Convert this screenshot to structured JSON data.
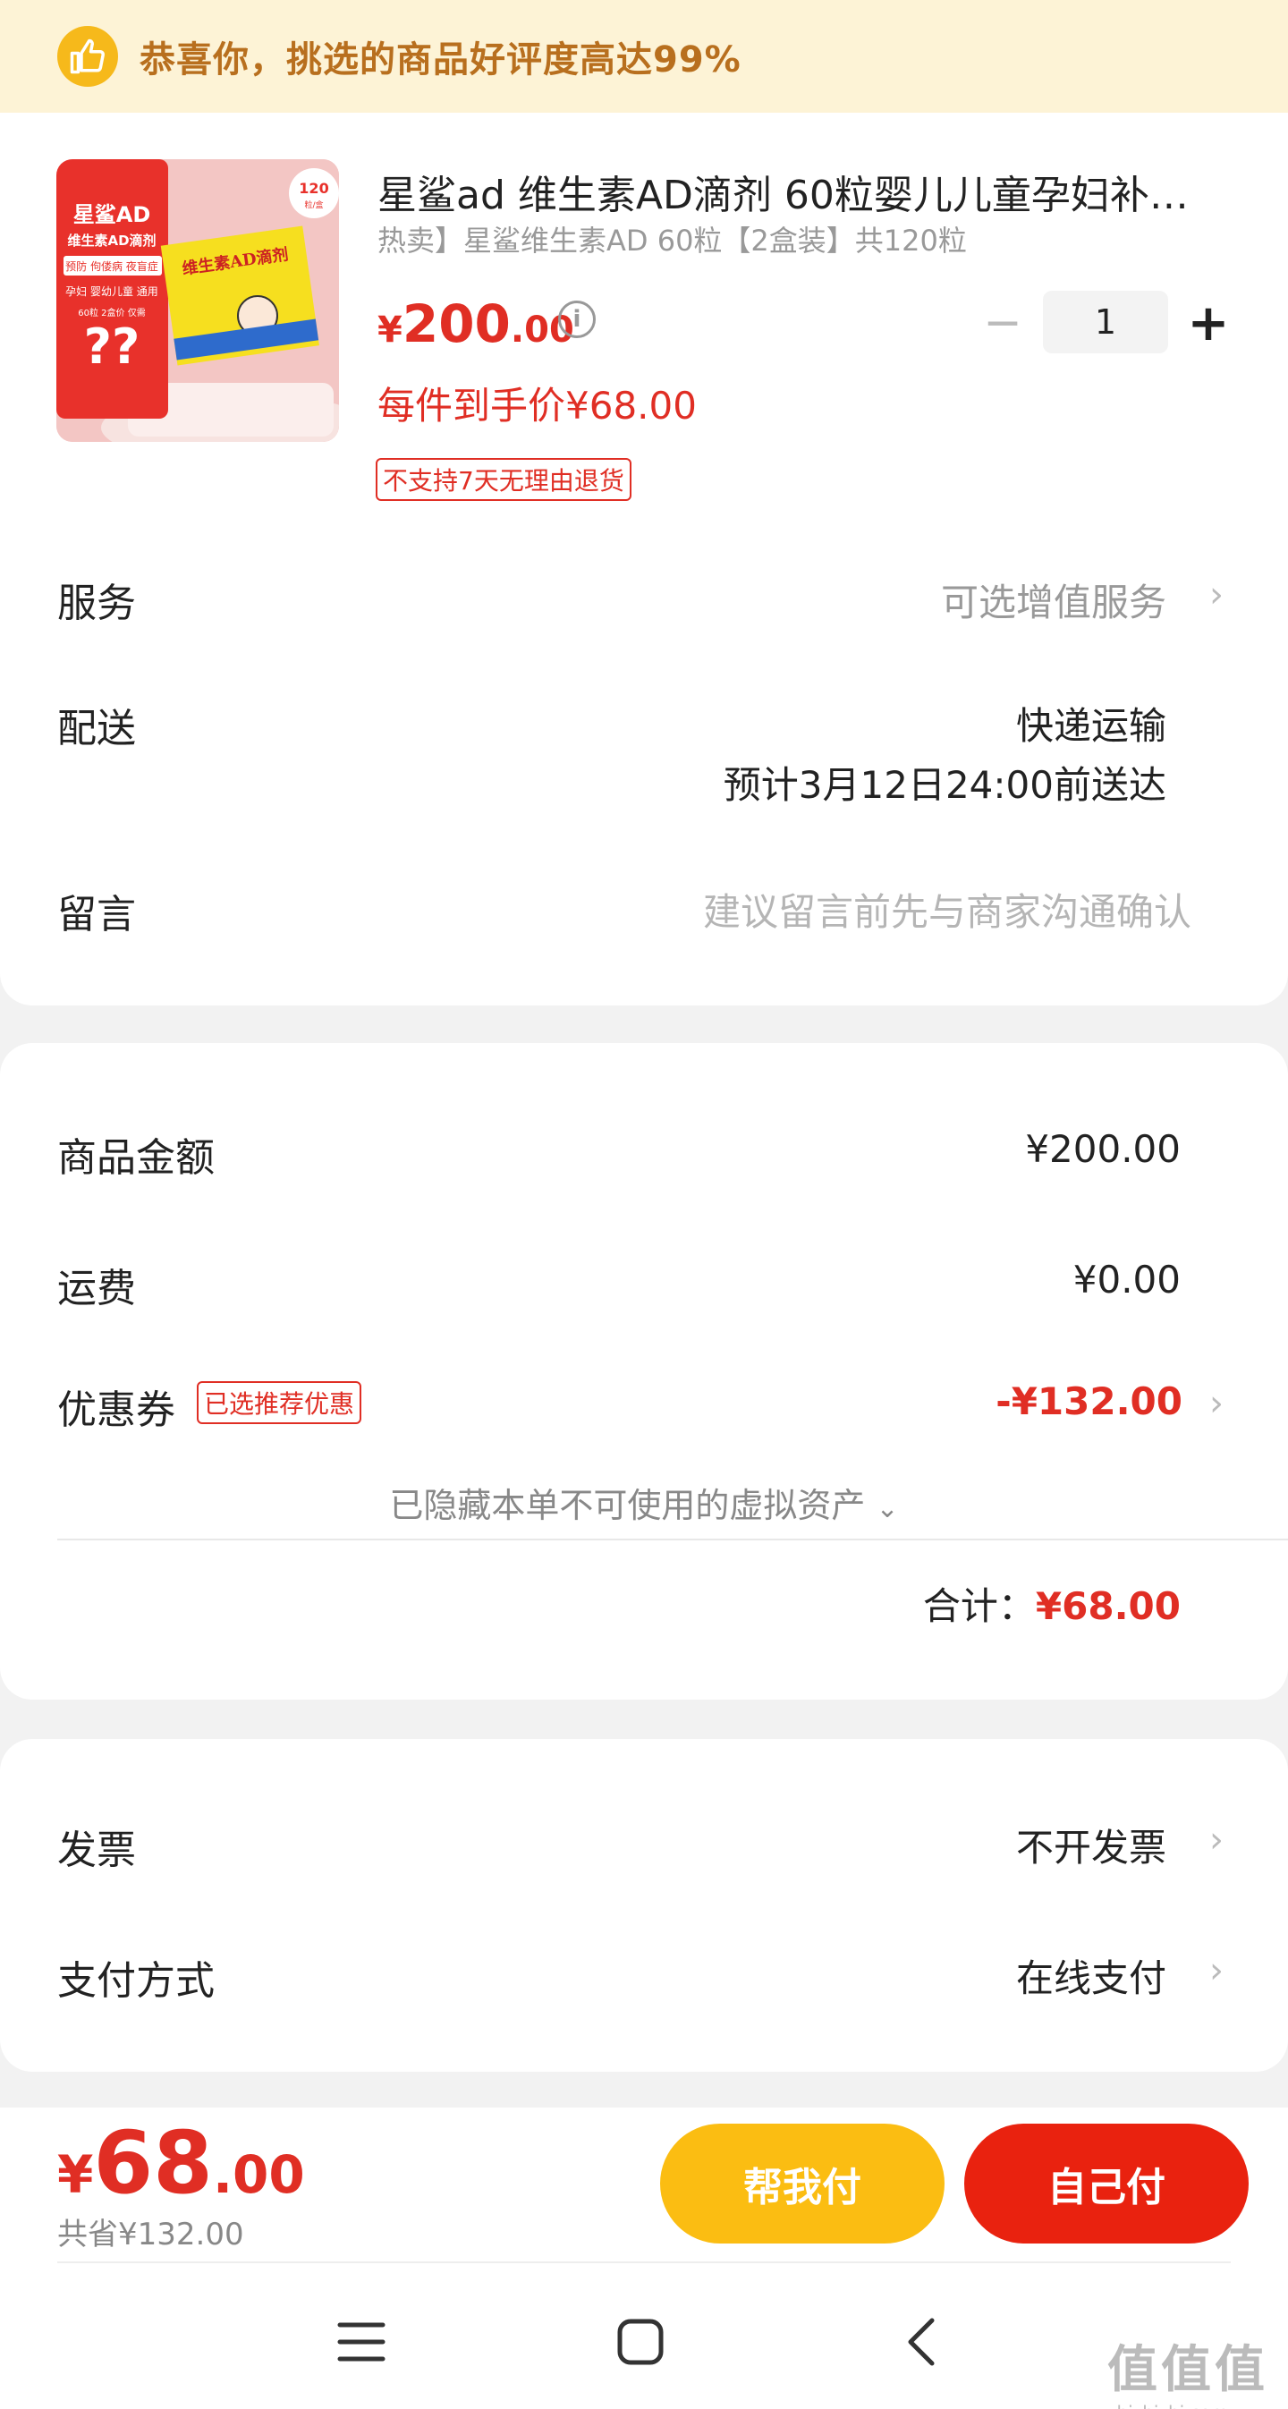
{
  "banner": {
    "icon": "thumbs-up-icon",
    "text": "恭喜你，挑选的商品好评度高达99%"
  },
  "product": {
    "image_texts": {
      "badge_number": "120",
      "badge_unit": "粒/盒",
      "brand": "星鲨AD",
      "name": "维生素AD滴剂",
      "uses1": "预防 佝偻病 夜盲症",
      "uses2": "孕妇 婴幼儿童 通用",
      "promo_small": "60粒 2盒价 仅需",
      "promo_price": "??",
      "box_title": "维生素AD滴剂"
    },
    "title": "星鲨ad 维生素AD滴剂 60粒婴儿儿童孕妇补…",
    "subtitle": "热卖】星鲨维生素AD 60粒【2盒装】共120粒",
    "price_currency": "¥",
    "price_int": "200",
    "price_dec": ".00",
    "info_icon": "info-icon",
    "quantity": "1",
    "minus": "−",
    "plus": "+",
    "unit_price": "每件到手价¥68.00",
    "return_tag": "不支持7天无理由退货"
  },
  "order_rows": {
    "service_label": "服务",
    "service_value": "可选增值服务",
    "delivery_label": "配送",
    "delivery_value1": "快递运输",
    "delivery_value2": "预计3月12日24:00前送达",
    "message_label": "留言",
    "message_placeholder": "建议留言前先与商家沟通确认"
  },
  "summary": {
    "goods_label": "商品金额",
    "goods_value": "¥200.00",
    "shipping_label": "运费",
    "shipping_value": "¥0.00",
    "coupon_label": "优惠券",
    "coupon_tag": "已选推荐优惠",
    "coupon_value": "-¥132.00",
    "hidden_assets": "已隐藏本单不可使用的虚拟资产",
    "total_label": "合计：",
    "total_value": "¥68.00"
  },
  "extra": {
    "invoice_label": "发票",
    "invoice_value": "不开发票",
    "payment_label": "支付方式",
    "payment_value": "在线支付"
  },
  "bottom": {
    "currency": "¥",
    "amount_int": "68",
    "amount_dec": ".00",
    "saved": "共省¥132.00",
    "help_pay": "帮我付",
    "self_pay": "自己付"
  },
  "watermark": {
    "title": "值值值",
    "url": "zhizhizhi.com"
  },
  "colors": {
    "accent_red": "#e02e24",
    "banner_bg": "#fdf3d6",
    "help_button": "#fbbd12",
    "self_button": "#e9220f"
  }
}
